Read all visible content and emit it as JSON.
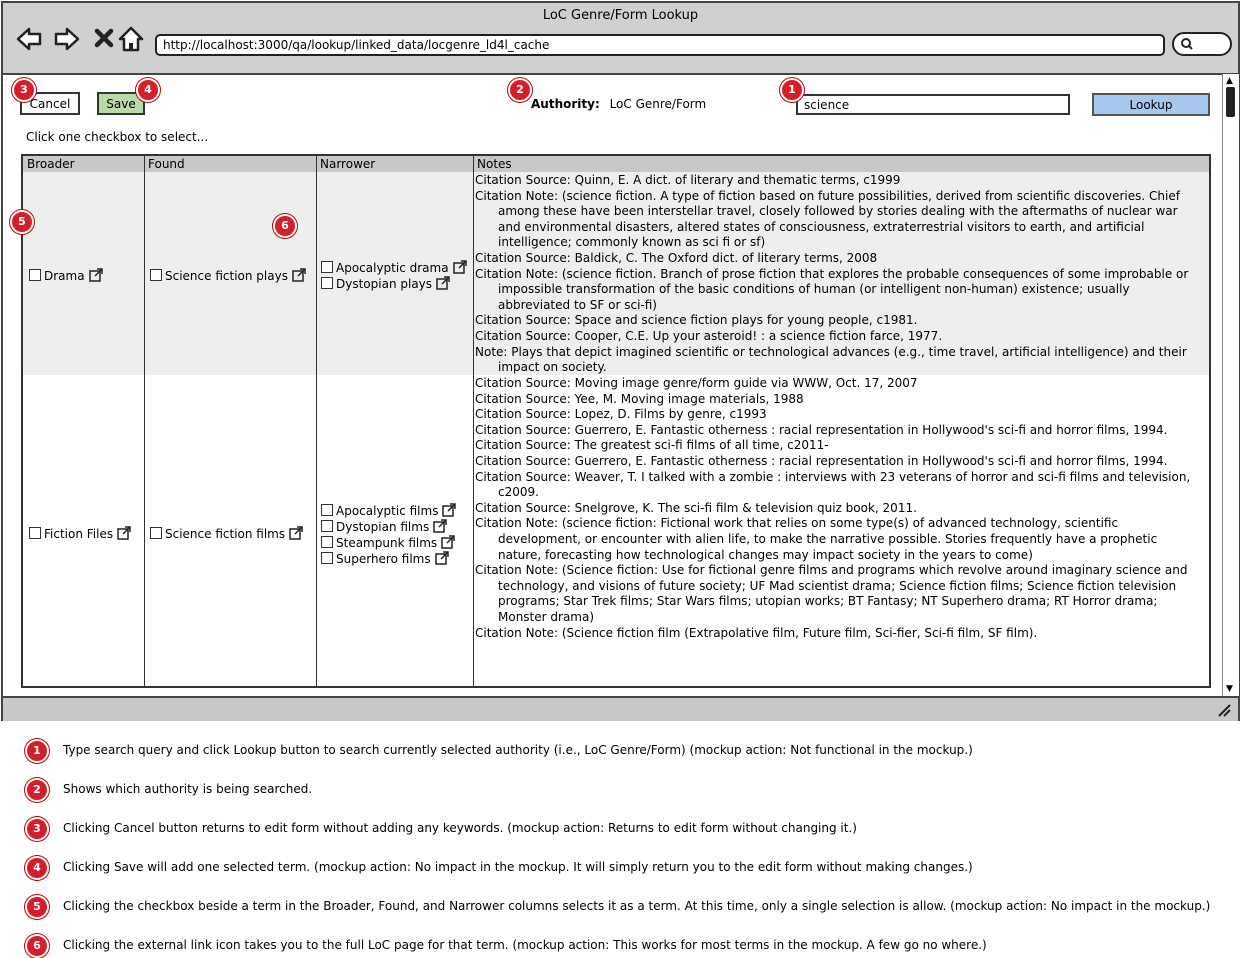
{
  "window": {
    "title": "LoC Genre/Form Lookup",
    "url": "http://localhost:3000/qa/lookup/linked_data/locgenre_ld4l_cache"
  },
  "toolbar": {
    "cancel_label": "Cancel",
    "save_label": "Save",
    "lookup_label": "Lookup"
  },
  "authority": {
    "label": "Authority:",
    "value": "LoC Genre/Form"
  },
  "search": {
    "value": "science"
  },
  "instructions": "Click one checkbox to select...",
  "badges": [
    "1",
    "2",
    "3",
    "4",
    "5",
    "6"
  ],
  "table": {
    "headers": [
      "Broader",
      "Found",
      "Narrower",
      "Notes"
    ],
    "rows": [
      {
        "broader": "Drama",
        "found": "Science fiction plays",
        "narrower": [
          "Apocalyptic drama",
          "Dystopian plays"
        ],
        "notes": [
          "Citation Source: Quinn, E. A dict. of literary and thematic terms, c1999",
          "Citation Note: (science fiction. A type of fiction based on future possibilities, derived from scientific discoveries. Chief among these have been interstellar travel, closely followed by stories dealing with the aftermaths of nuclear war and environmental disasters, altered states of consciousness, extraterrestrial visitors to earth, and artificial intelligence; commonly known as sci fi or sf)",
          "Citation Source: Baldick, C. The Oxford dict. of literary terms, 2008",
          "Citation Note: (science fiction. Branch of prose fiction that explores the probable consequences of some improbable or impossible transformation of the basic conditions of human (or intelligent non-human) existence; usually abbreviated to SF or sci-fi)",
          "Citation Source: Space and science fiction plays for young people, c1981.",
          "Citation Source: Cooper, C.E. Up your asteroid! : a science fiction farce, 1977.",
          "Note:  Plays that depict imagined scientific or technological advances (e.g., time travel, artificial intelligence) and their impact on society."
        ]
      },
      {
        "broader": "Fiction Files",
        "found": "Science fiction films",
        "narrower": [
          "Apocalyptic films",
          "Dystopian films",
          "Steampunk films",
          "Superhero films"
        ],
        "notes": [
          "Citation Source: Moving image genre/form guide via WWW, Oct. 17, 2007",
          "Citation Source: Yee, M. Moving image materials, 1988",
          "Citation Source: Lopez, D. Films by genre, c1993",
          "Citation Source: Guerrero, E. Fantastic otherness : racial representation in Hollywood's sci-fi and horror films, 1994.",
          "Citation Source: The greatest sci-fi films of all time, c2011-",
          "Citation Source: Guerrero, E. Fantastic otherness : racial representation in Hollywood's sci-fi and horror films, 1994.",
          "Citation Source: Weaver, T. I talked with a zombie : interviews with 23 veterans of horror and sci-fi films and television, c2009.",
          "Citation Source: Snelgrove, K. The sci-fi film & television quiz book, 2011.",
          "Citation Note: (science fiction: Fictional work that relies on some type(s) of advanced technology, scientific development, or encounter with alien life, to make the narrative possible. Stories frequently have a prophetic nature, forecasting how technological changes may impact society in the years to come)",
          "Citation Note: (Science fiction: Use for fictional genre films and programs which revolve around imaginary science and technology, and visions of future society; UF Mad scientist drama; Science fiction films; Science fiction television programs; Star Trek films; Star Wars films; utopian works; BT Fantasy; NT Superhero drama; RT Horror drama; Monster drama)",
          "Citation Note: (Science fiction film (Extrapolative film, Future film, Sci-fier, Sci-fi film, SF film)."
        ]
      }
    ]
  },
  "legend": [
    {
      "num": "1",
      "text": "Type search query and click Lookup button to search currently selected authority (i.e., LoC Genre/Form)  (mockup action: Not functional in the mockup.)"
    },
    {
      "num": "2",
      "text": "Shows which authority is being searched."
    },
    {
      "num": "3",
      "text": "Clicking Cancel button returns to edit form without adding any keywords.  (mockup action: Returns to edit form without changing it.)"
    },
    {
      "num": "4",
      "text": "Clicking Save will add one selected term.  (mockup action: No impact in the mockup.  It will simply return you to the edit form without making changes.)"
    },
    {
      "num": "5",
      "text": "Clicking the checkbox beside a term in the Broader, Found, and Narrower columns selects it as a term.  At this time, only a single selection is allow.  (mockup action: No impact in the mockup.)"
    },
    {
      "num": "6",
      "text": "Clicking the external link icon takes you to the full LoC page for that term.  (mockup action: This works for most terms in the mockup.  A few go no where.)"
    }
  ],
  "colors": {
    "badge": "#d41f2a",
    "save": "#b9d9a6",
    "lookup": "#a6c8ef",
    "chrome": "#d0d0d0",
    "row_alt": "#eeeeee"
  },
  "icons": [
    "back-arrow-icon",
    "forward-arrow-icon",
    "stop-icon",
    "home-icon",
    "search-icon",
    "external-link-icon",
    "resize-grip-icon"
  ]
}
